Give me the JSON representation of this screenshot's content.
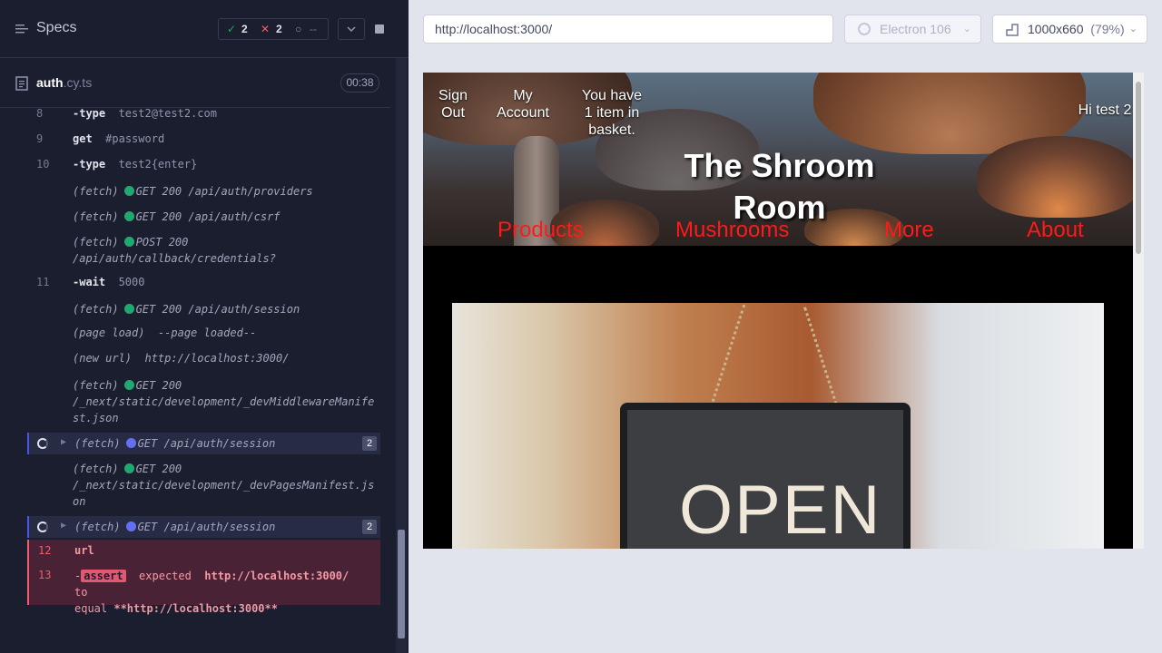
{
  "sidebar": {
    "title": "Specs",
    "stats": {
      "passed": "2",
      "failed": "2",
      "pending": "--"
    },
    "file": {
      "name": "auth",
      "ext": ".cy.ts",
      "time": "00:38"
    }
  },
  "commands": [
    {
      "num": "8",
      "kw": "-type",
      "arg": "test2@test2.com"
    },
    {
      "num": "9",
      "kw": "get",
      "arg": "#password"
    },
    {
      "num": "10",
      "kw": "-type",
      "arg": "test2{enter}"
    },
    {
      "tag": "(fetch)",
      "dot": "green",
      "text": "GET 200 /api/auth/providers"
    },
    {
      "tag": "(fetch)",
      "dot": "green",
      "text": "GET 200 /api/auth/csrf"
    },
    {
      "tag": "(fetch)",
      "dot": "green",
      "text": "POST 200",
      "text2": "/api/auth/callback/credentials?"
    },
    {
      "num": "11",
      "kw": "-wait",
      "arg": "5000"
    },
    {
      "tag": "(fetch)",
      "dot": "green",
      "text": "GET 200 /api/auth/session"
    },
    {
      "tag": "(page load)",
      "text": "--page loaded--"
    },
    {
      "tag": "(new url)",
      "text": "http://localhost:3000/"
    },
    {
      "tag": "(fetch)",
      "dot": "green",
      "text": "GET 200",
      "text2": "/_next/static/development/_devMiddlewareManife",
      "text3": "st.json"
    },
    {
      "tag": "(fetch)",
      "dot": "blue",
      "text": "GET /api/auth/session",
      "count": "2"
    },
    {
      "tag": "(fetch)",
      "dot": "green",
      "text": "GET 200",
      "text2": "/_next/static/development/_devPagesManifest.js",
      "text3": "on"
    },
    {
      "tag": "(fetch)",
      "dot": "blue",
      "text": "GET /api/auth/session",
      "count": "2"
    },
    {
      "num": "12",
      "kw": "url"
    },
    {
      "num": "13",
      "prefix": "-",
      "assert": "assert",
      "msg1": "expected",
      "val1": "http://localhost:3000/",
      "msg2": "to",
      "msg3": "equal",
      "val2": "**http://localhost:3000**"
    }
  ],
  "toolbar": {
    "url": "http://localhost:3000/",
    "browser": "Electron 106",
    "viewport": "1000x660",
    "scale": "(79%)"
  },
  "site": {
    "nav": {
      "sign_out_1": "Sign",
      "sign_out_2": "Out",
      "account_1": "My",
      "account_2": "Account",
      "basket_1": "You have",
      "basket_2": "1 item in",
      "basket_3": "basket.",
      "greeting": "Hi test 2"
    },
    "title_1": "The Shroom",
    "title_2": "Room",
    "menu": [
      "Products",
      "Mushrooms",
      "More",
      "About"
    ],
    "photo_text": "OPEN"
  }
}
